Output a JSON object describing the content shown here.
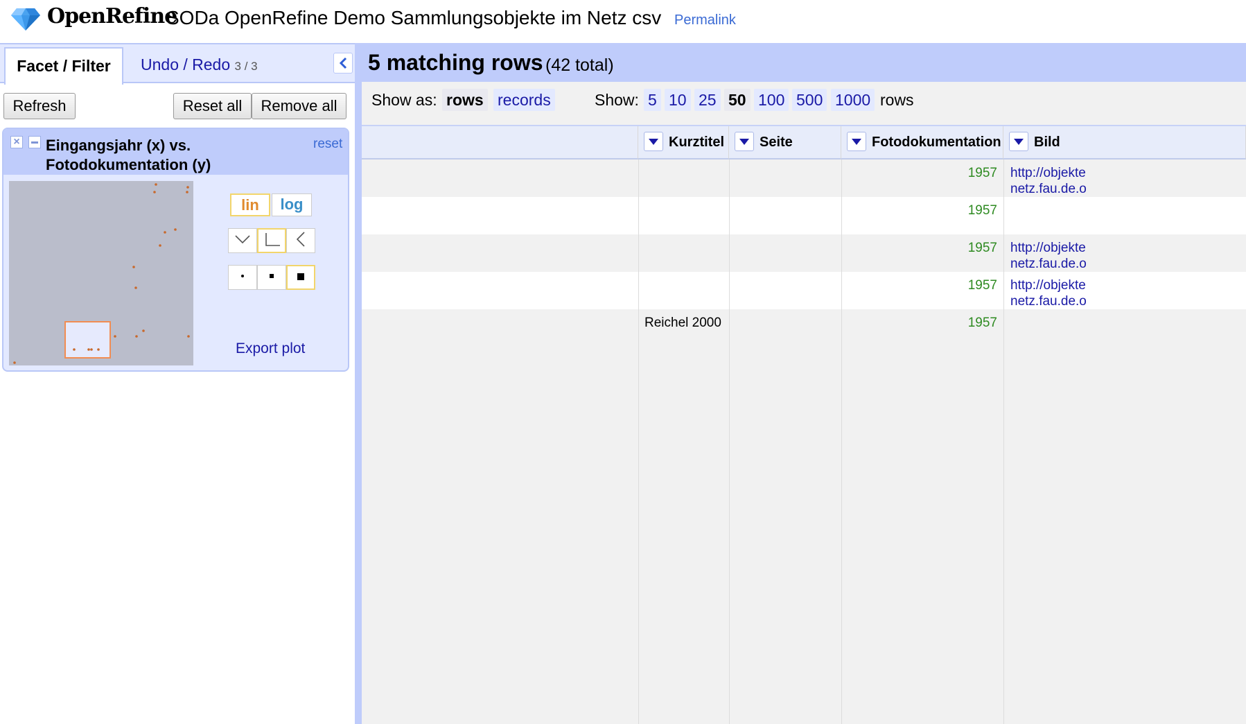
{
  "app": {
    "logo_text": "OpenRefine",
    "project_title": "SODa OpenRefine Demo Sammlungsobjekte im Netz csv",
    "permalink": "Permalink"
  },
  "left": {
    "tabs": {
      "facet": "Facet / Filter",
      "undo": "Undo / Redo",
      "undo_count": "3 / 3"
    },
    "buttons": {
      "refresh": "Refresh",
      "reset_all": "Reset all",
      "remove_all": "Remove all"
    },
    "facet": {
      "title": "Eingangsjahr (x) vs. Fotodokumentation (y)",
      "reset": "reset",
      "scale": {
        "lin": "lin",
        "log": "log",
        "selected": "lin"
      },
      "rotation_selected": "none",
      "dot_size_selected": "large",
      "export": "Export plot"
    }
  },
  "right": {
    "summary": {
      "matching": "5 matching rows",
      "total": "(42 total)"
    },
    "view": {
      "show_as_label": "Show as:",
      "modes": [
        "rows",
        "records"
      ],
      "selected_mode": "rows",
      "show_label": "Show:",
      "page_sizes": [
        "5",
        "10",
        "25",
        "50",
        "100",
        "500",
        "1000"
      ],
      "selected_size": "50",
      "rows_label": "rows"
    },
    "columns": [
      "Kurztitel",
      "Seite",
      "Fotodokumentation",
      "Bild"
    ],
    "rows": [
      {
        "kurztitel": "",
        "seite": "",
        "foto": "1957",
        "bild1": "http://objekte",
        "bild2": "netz.fau.de.o"
      },
      {
        "kurztitel": "",
        "seite": "",
        "foto": "1957",
        "bild1": "",
        "bild2": ""
      },
      {
        "kurztitel": "",
        "seite": "",
        "foto": "1957",
        "bild1": "http://objekte",
        "bild2": "netz.fau.de.o"
      },
      {
        "kurztitel": "",
        "seite": "",
        "foto": "1957",
        "bild1": "http://objekte",
        "bild2": "netz.fau.de.o"
      },
      {
        "kurztitel": "Reichel 2000",
        "seite": "",
        "foto": "1957",
        "bild1": "",
        "bild2": ""
      }
    ]
  },
  "colors": {
    "accent": "#bfccfb",
    "link": "#1a1aa6",
    "number": "#2e8a21",
    "plot_point": "#c8692c",
    "selection": "#f28c52"
  }
}
